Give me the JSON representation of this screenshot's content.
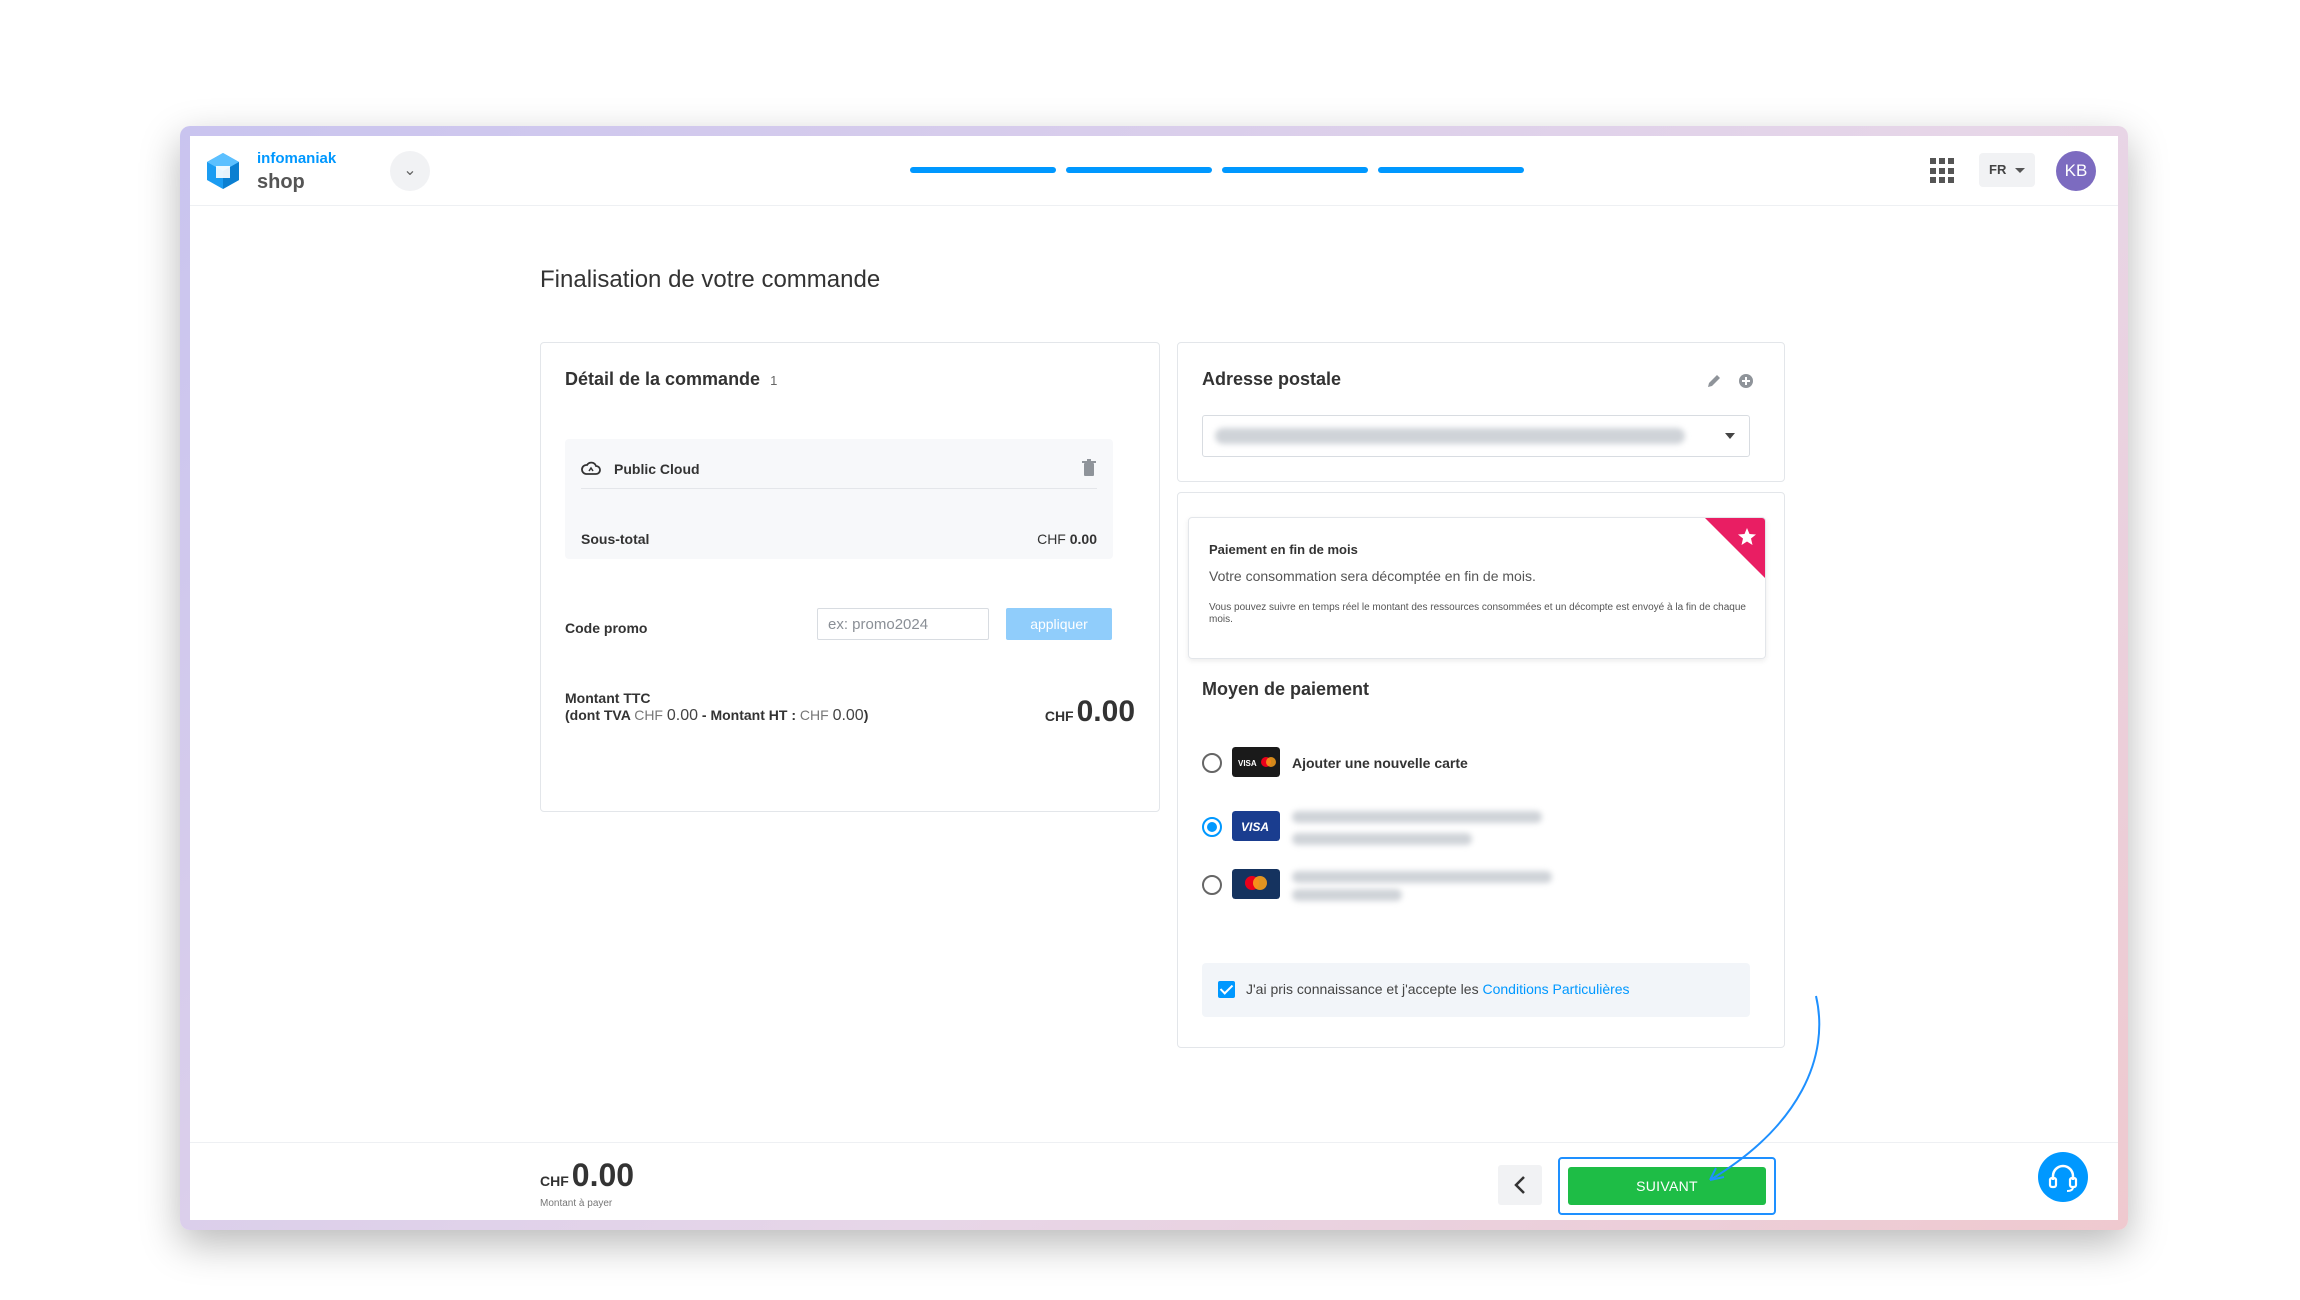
{
  "brand": {
    "name": "infomaniak",
    "product": "shop"
  },
  "header": {
    "lang": "FR",
    "avatar_initials": "KB",
    "steps_total": 4,
    "steps_done": 4
  },
  "page": {
    "title": "Finalisation de votre commande"
  },
  "order": {
    "title": "Détail de la commande",
    "count": "1",
    "items": [
      {
        "name": "Public Cloud",
        "icon": "cloud-icon"
      }
    ],
    "subtotal_label": "Sous-total",
    "subtotal_currency": "CHF",
    "subtotal_value": "0.00",
    "promo_label": "Code promo",
    "promo_placeholder": "ex: promo2024",
    "promo_button": "appliquer",
    "total_label": "Montant TTC",
    "tax_prefix": "(dont TVA",
    "tax_currency": "CHF",
    "tax_value": "0.00",
    "ht_label": "- Montant HT :",
    "ht_currency": "CHF",
    "ht_value": "0.00",
    "total_currency": "CHF",
    "total_value": "0.00"
  },
  "address": {
    "title": "Adresse postale"
  },
  "payment": {
    "end_of_month_title": "Paiement en fin de mois",
    "end_of_month_desc": "Votre consommation sera décomptée en fin de mois.",
    "end_of_month_note": "Vous pouvez suivre en temps réel le montant des ressources consommées et un décompte est envoyé à la fin de chaque mois.",
    "method_title": "Moyen de paiement",
    "methods": [
      {
        "label": "Ajouter une nouvelle carte",
        "brand": "visa-mastercard",
        "selected": false
      },
      {
        "label": "",
        "brand": "VISA",
        "selected": true
      },
      {
        "label": "",
        "brand": "mastercard",
        "selected": false
      }
    ],
    "terms_text": "J'ai pris connaissance et j'accepte les",
    "terms_link": "Conditions Particulières",
    "terms_checked": true
  },
  "footer": {
    "amount_currency": "CHF",
    "amount_value": "0.00",
    "amount_label": "Montant à payer",
    "back_icon": "chevron-left-icon",
    "next_label": "SUIVANT"
  },
  "colors": {
    "primary": "#0098ff",
    "success": "#1ebd46",
    "ribbon": "#e91e63",
    "avatar": "#7c6bc0"
  }
}
